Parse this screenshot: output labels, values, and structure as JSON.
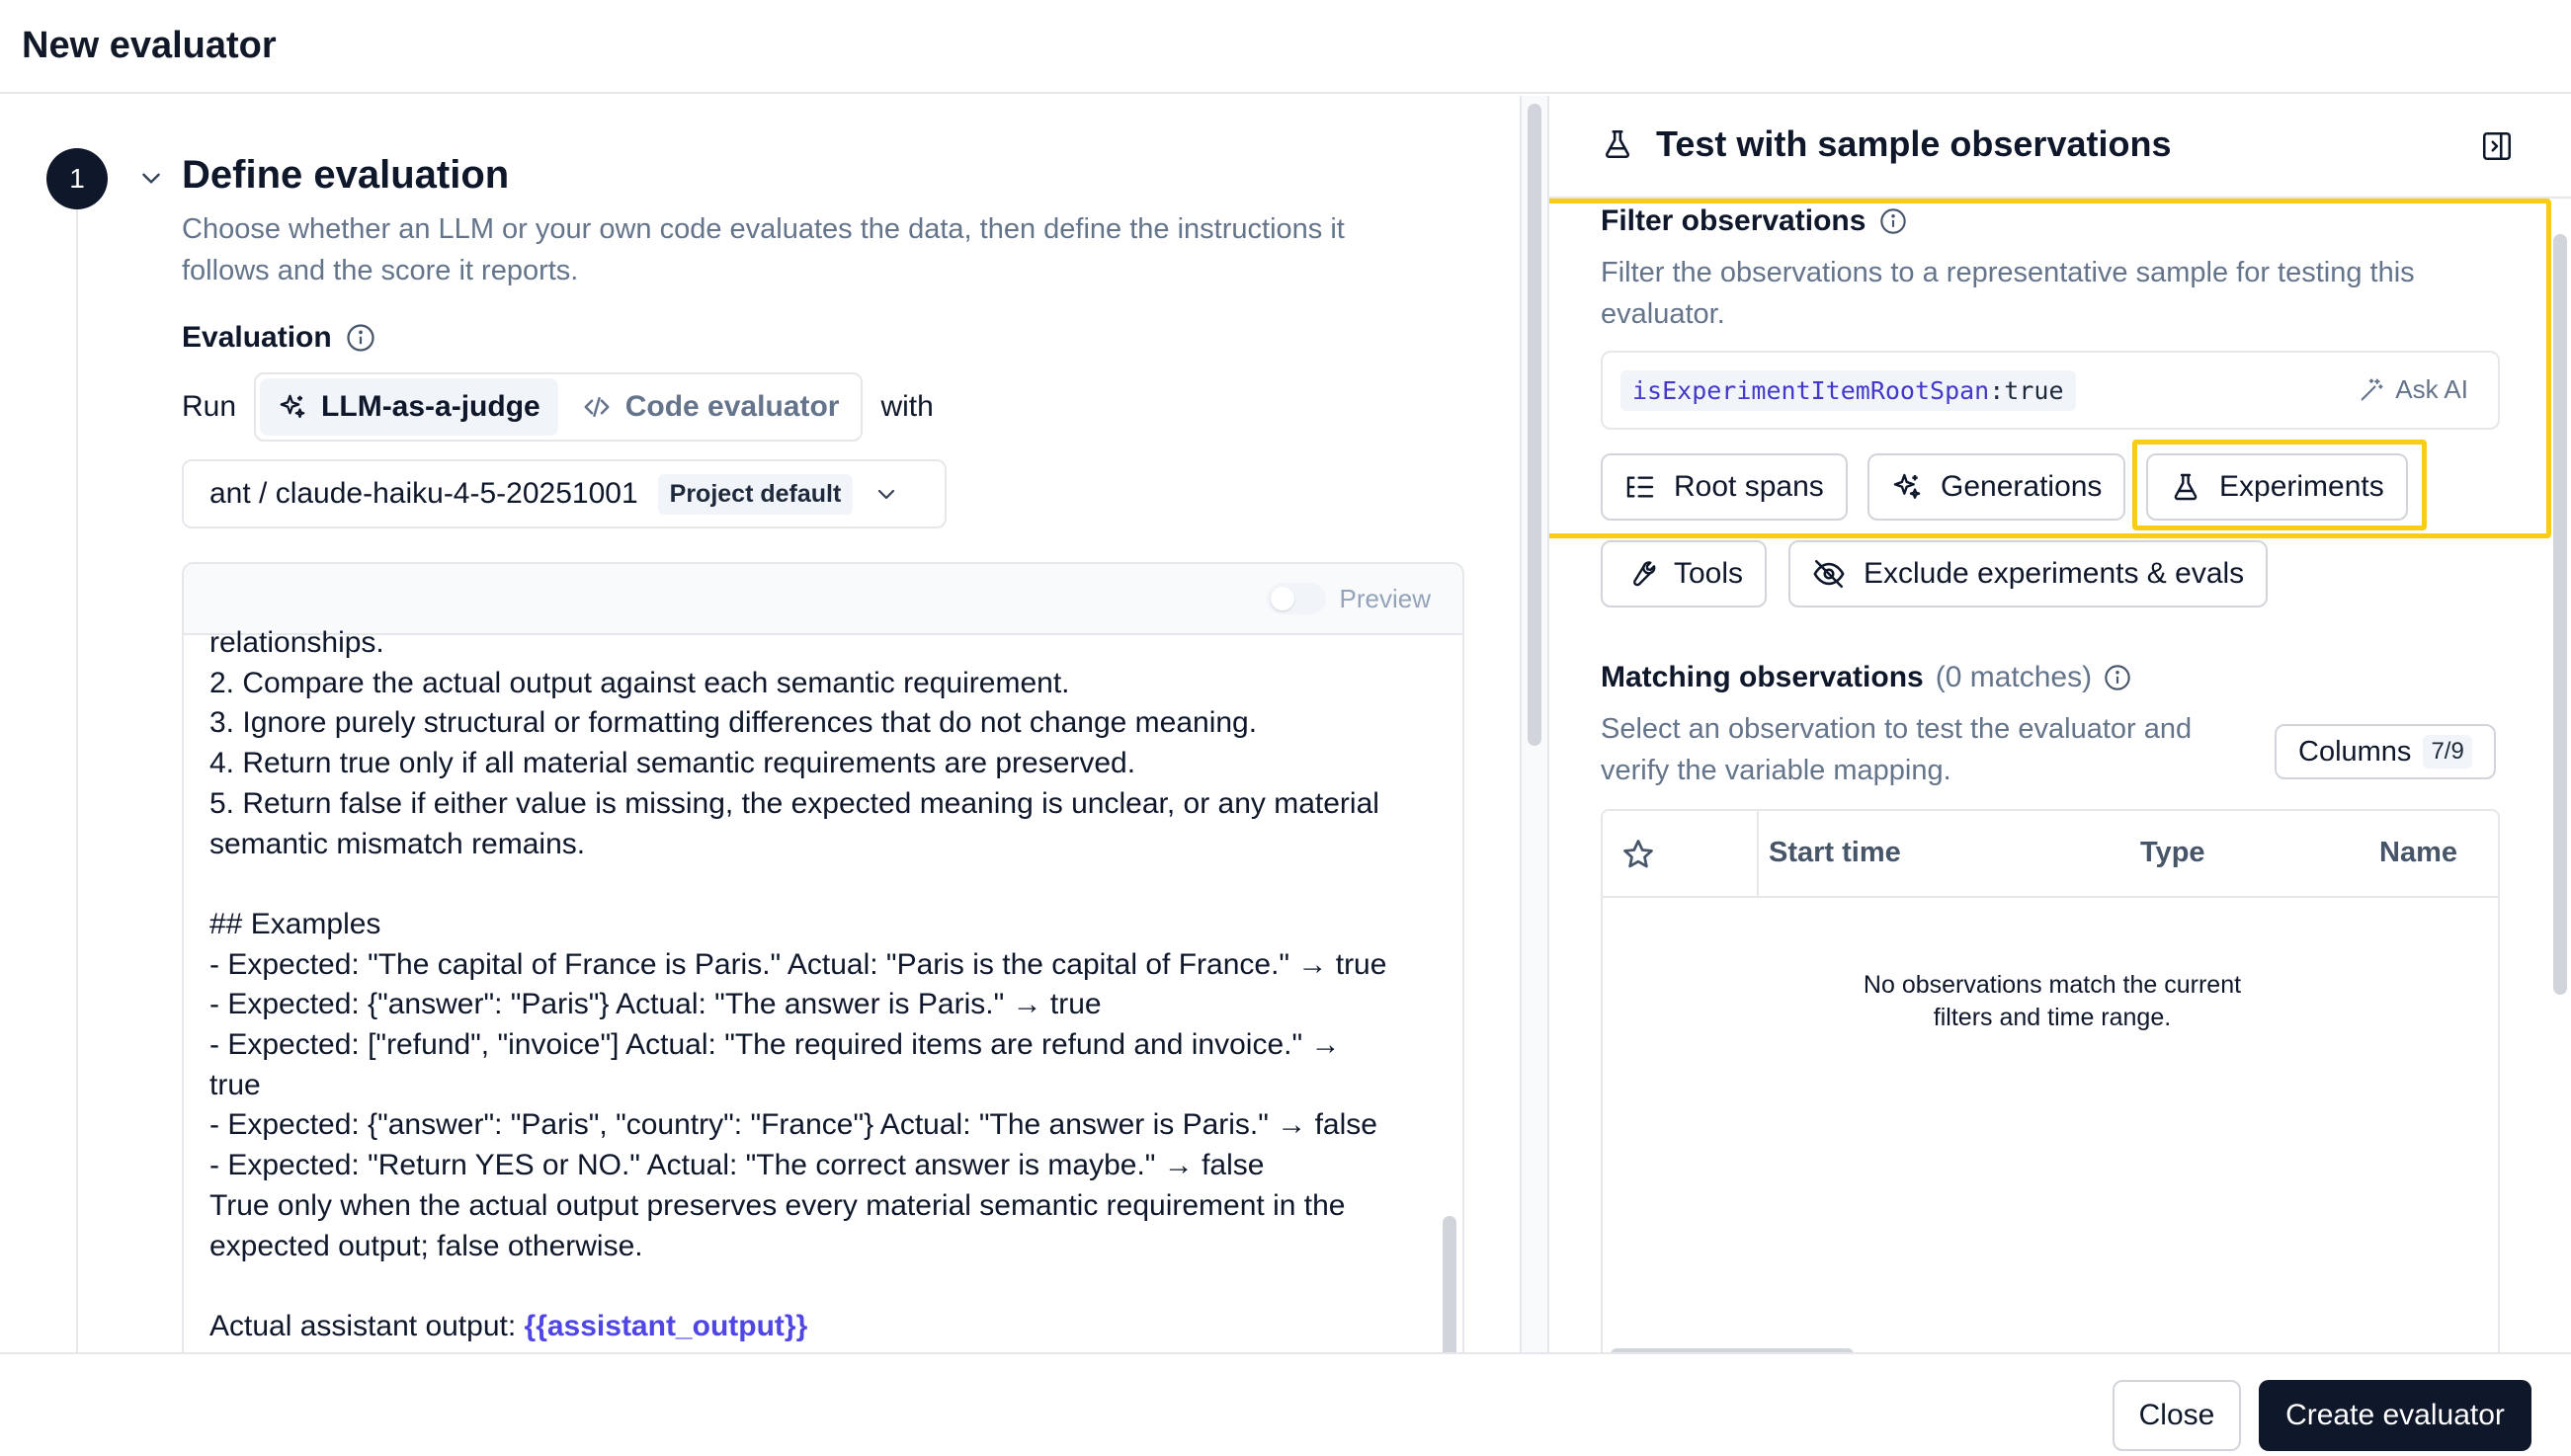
{
  "header": {
    "title": "New evaluator"
  },
  "step": {
    "number": "1",
    "title": "Define evaluation",
    "description": "Choose whether an LLM or your own code evaluates the data, then define the instructions it follows and the score it reports."
  },
  "evaluation": {
    "label": "Evaluation",
    "run_label": "Run",
    "with_label": "with",
    "modes": [
      {
        "label": "LLM-as-a-judge",
        "active": true,
        "icon": "sparkles-icon"
      },
      {
        "label": "Code evaluator",
        "active": false,
        "icon": "code-icon"
      }
    ],
    "model": {
      "value": "ant / claude-haiku-4-5-20251001",
      "badge": "Project default"
    }
  },
  "editor": {
    "preview_label": "Preview",
    "lines": [
      "relationships.",
      "2. Compare the actual output against each semantic requirement.",
      "3. Ignore purely structural or formatting differences that do not change meaning.",
      "4. Return true only if all material semantic requirements are preserved.",
      "5. Return false if either value is missing, the expected meaning is unclear, or any material",
      "semantic mismatch remains.",
      "",
      "## Examples",
      "- Expected: \"The capital of France is Paris.\" Actual: \"Paris is the capital of France.\" → true",
      "- Expected: {\"answer\": \"Paris\"} Actual: \"The answer is Paris.\" → true",
      "- Expected: [\"refund\", \"invoice\"] Actual: \"The required items are refund and invoice.\" →",
      "true",
      "- Expected: {\"answer\": \"Paris\", \"country\": \"France\"} Actual: \"The answer is Paris.\" → false",
      "- Expected: \"Return YES or NO.\" Actual: \"The correct answer is maybe.\" → false",
      "True only when the actual output preserves every material semantic requirement in the",
      "expected output; false otherwise.",
      ""
    ],
    "last_line_prefix": "Actual assistant output: ",
    "last_line_var": "{{assistant_output}}"
  },
  "test_panel": {
    "title": "Test with sample observations",
    "filter": {
      "title": "Filter observations",
      "description": "Filter the observations to a representative sample for testing this evaluator.",
      "query_key": "isExperimentItemRootSpan",
      "query_value": ":true",
      "ask_ai": "Ask AI",
      "presets": [
        {
          "label": "Root spans",
          "icon": "list-tree-icon"
        },
        {
          "label": "Generations",
          "icon": "sparkles-icon"
        },
        {
          "label": "Experiments",
          "icon": "flask-icon"
        },
        {
          "label": "Tools",
          "icon": "wrench-icon"
        },
        {
          "label": "Exclude experiments & evals",
          "icon": "eye-off-icon"
        }
      ]
    },
    "matching": {
      "title": "Matching observations",
      "count": "(0 matches)",
      "description": "Select an observation to test the evaluator and verify the variable mapping.",
      "columns_label": "Columns",
      "columns_badge": "7/9",
      "headers": [
        "Start time",
        "Type",
        "Name"
      ],
      "empty_line1": "No observations match the current",
      "empty_line2": "filters and time range."
    }
  },
  "footer": {
    "close": "Close",
    "create": "Create evaluator"
  }
}
